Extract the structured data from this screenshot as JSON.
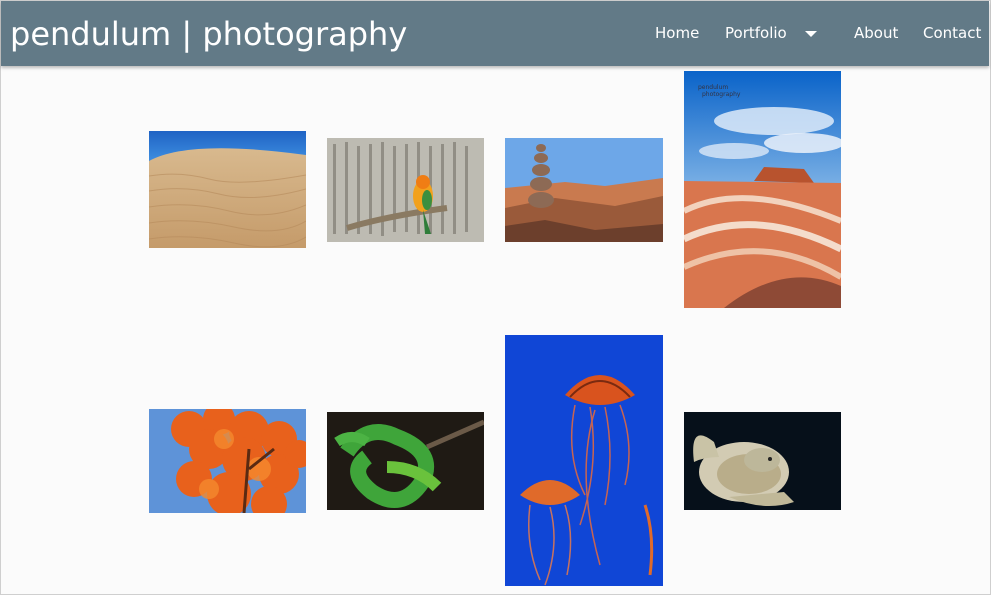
{
  "header": {
    "brand": "pendulum | photography",
    "nav": {
      "home": "Home",
      "portfolio": "Portfolio",
      "about": "About",
      "contact": "Contact"
    },
    "portfolio_dropdown_icon": "caret-down-icon"
  },
  "gallery": {
    "watermark_line1": "pendulum",
    "watermark_line2": "photography",
    "photos": [
      {
        "subject": "sand-dunes"
      },
      {
        "subject": "parrot-calligraphy"
      },
      {
        "subject": "rock-cairn"
      },
      {
        "subject": "red-rock-canyon"
      },
      {
        "subject": "autumn-tree"
      },
      {
        "subject": "green-snake"
      },
      {
        "subject": "jellyfish"
      },
      {
        "subject": "sea-turtle"
      }
    ]
  },
  "colors": {
    "header_bg": "#627a87",
    "header_text": "#ffffff",
    "page_bg": "#fbfbfb"
  }
}
